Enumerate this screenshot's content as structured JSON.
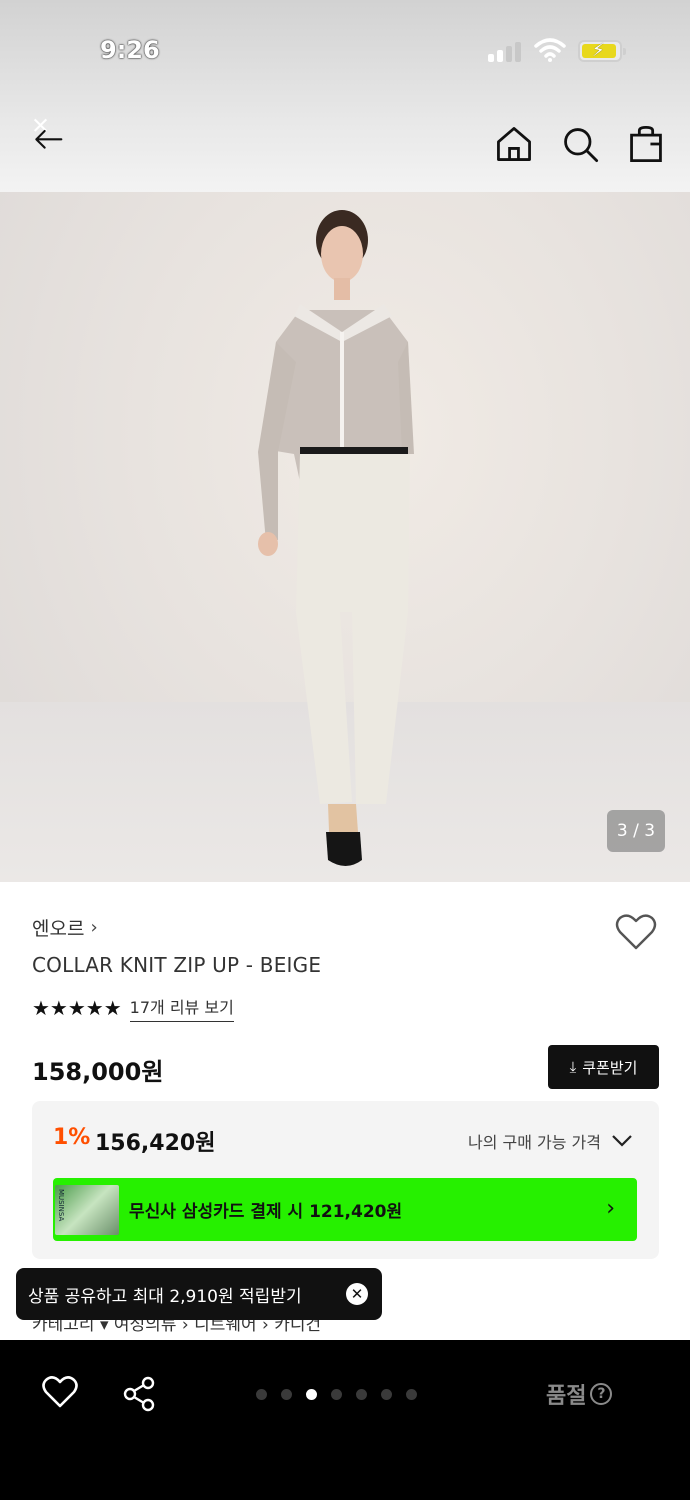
{
  "status_bar": {
    "time": "9:26"
  },
  "header": {
    "back_icon": "back-arrow-icon",
    "home_icon": "home-icon",
    "search_icon": "search-icon",
    "bag_icon": "shopping-bag-icon"
  },
  "gallery": {
    "counter": "3 / 3",
    "current_index": 3,
    "total": 3
  },
  "product": {
    "brand": "엔오르",
    "brand_chevron": "›",
    "name": "COLLAR KNIT ZIP UP - BEIGE",
    "stars": "★★★★★",
    "rating_stars": 5,
    "review_link": "17개 리뷰 보기",
    "price": "158,000원",
    "coupon_label": "쿠폰받기",
    "coupon_icon": "⤓"
  },
  "price_box": {
    "discount_rate": "1%",
    "discount_price": "156,420원",
    "my_price_label": "나의 구매 가능 가격",
    "card_banner_text": "무신사 삼성카드 결제 시 121,420원",
    "card_arrow": "›",
    "card_thumb_text": "MUSINSA",
    "banner_color": "#26f000",
    "discount_color": "#ff4f00"
  },
  "toast": {
    "text": "상품 공유하고 최대 2,910원 적립받기",
    "close": "✕"
  },
  "breadcrumb": {
    "text": "카테고리  ▾ 여성의류 › 니트웨어 › 카디건"
  },
  "bottom_bar": {
    "dots_count": 7,
    "active_dot": 3,
    "soldout_label": "품절",
    "help_glyph": "?"
  }
}
